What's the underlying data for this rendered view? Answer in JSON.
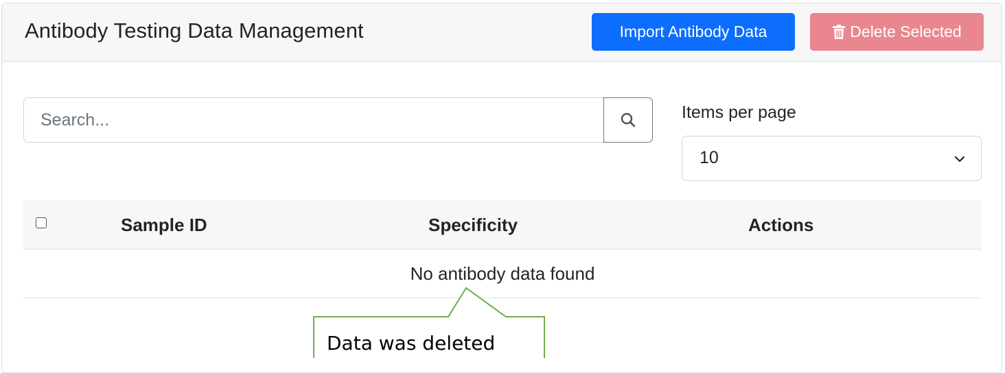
{
  "header": {
    "title": "Antibody Testing Data Management",
    "import_label": "Import Antibody Data",
    "delete_label": "Delete Selected"
  },
  "search": {
    "placeholder": "Search..."
  },
  "pagination": {
    "items_per_page_label": "Items per page",
    "items_per_page_value": "10"
  },
  "table": {
    "columns": [
      "Sample ID",
      "Specificity",
      "Actions"
    ],
    "empty_message": "No antibody data found"
  },
  "annotation": {
    "text": "Data was deleted"
  },
  "colors": {
    "primary": "#0d6efd",
    "danger_disabled": "#ea868f",
    "callout_border": "#70ad47"
  },
  "icons": {
    "delete_button": "trash-icon",
    "search_button": "search-icon",
    "select": "chevron-down-icon"
  }
}
